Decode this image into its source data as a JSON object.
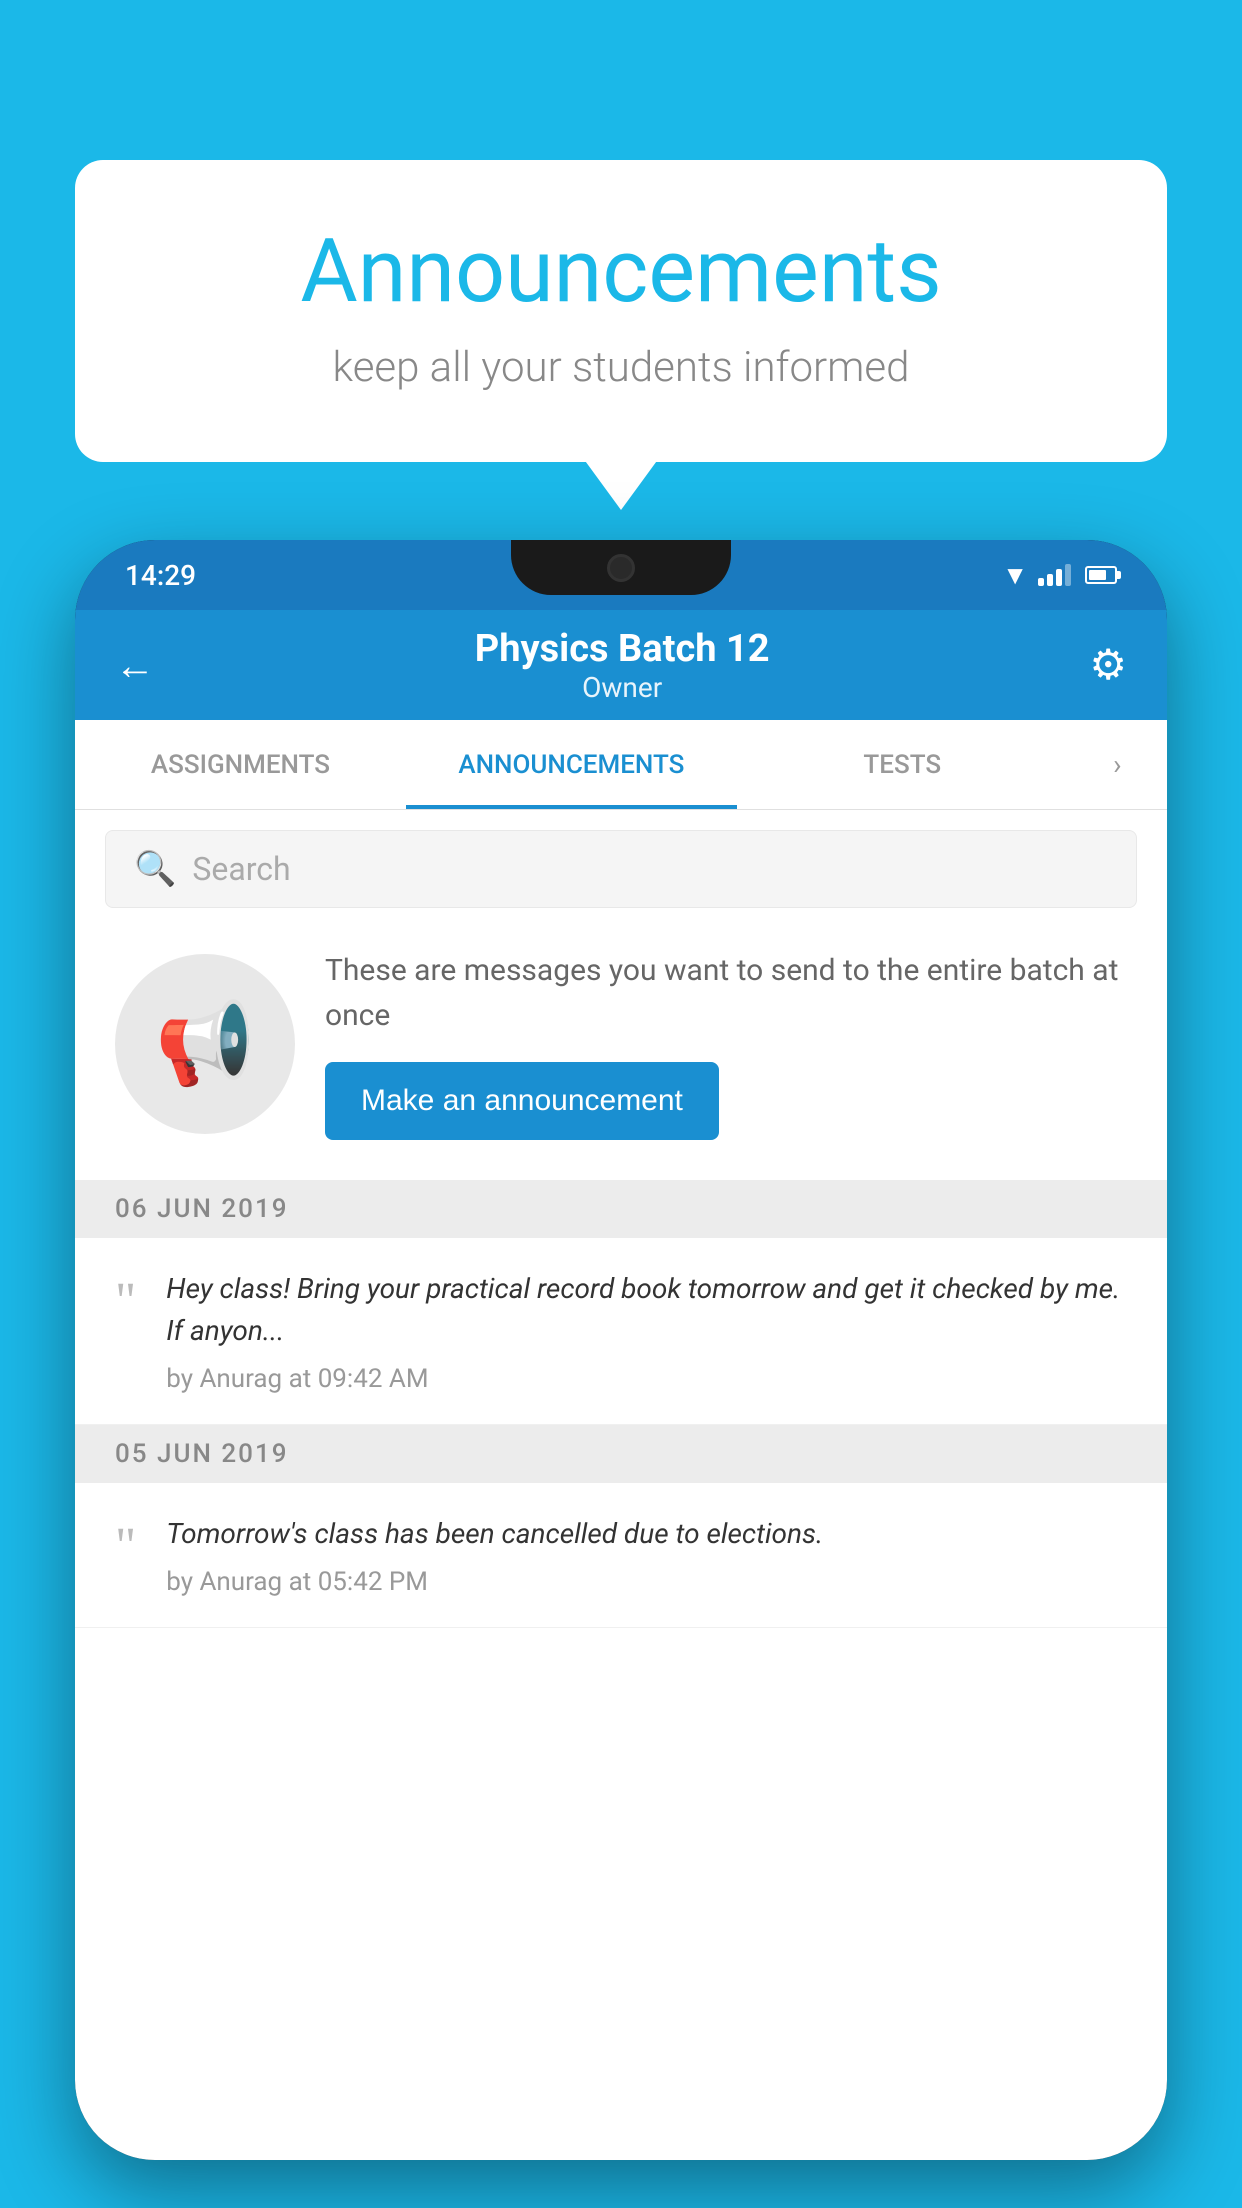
{
  "background_color": "#1bb8e8",
  "speech_bubble": {
    "title": "Announcements",
    "subtitle": "keep all your students informed"
  },
  "status_bar": {
    "time": "14:29"
  },
  "app_header": {
    "title": "Physics Batch 12",
    "subtitle": "Owner",
    "back_label": "←",
    "gear_label": "⚙"
  },
  "tabs": [
    {
      "label": "ASSIGNMENTS",
      "active": false
    },
    {
      "label": "ANNOUNCEMENTS",
      "active": true
    },
    {
      "label": "TESTS",
      "active": false
    }
  ],
  "search": {
    "placeholder": "Search"
  },
  "promo": {
    "text": "These are messages you want to send to the entire batch at once",
    "button_label": "Make an announcement"
  },
  "announcements": [
    {
      "date": "06  JUN  2019",
      "text": "Hey class! Bring your practical record book tomorrow and get it checked by me. If anyon...",
      "meta": "by Anurag at 09:42 AM"
    },
    {
      "date": "05  JUN  2019",
      "text": "Tomorrow's class has been cancelled due to elections.",
      "meta": "by Anurag at 05:42 PM"
    }
  ]
}
